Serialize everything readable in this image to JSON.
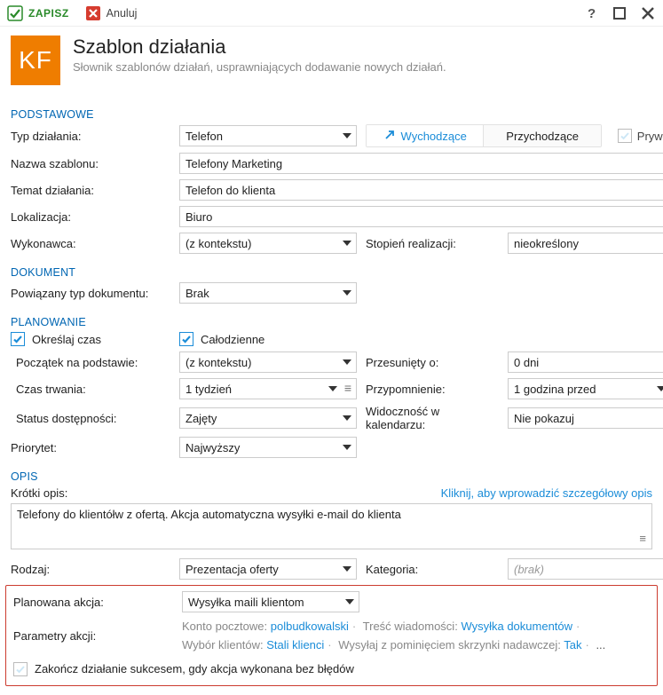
{
  "titlebar": {
    "save": "ZAPISZ",
    "cancel": "Anuluj"
  },
  "header": {
    "logo": "KF",
    "title": "Szablon działania",
    "subtitle": "Słownik szablonów działań, usprawniających dodawanie nowych działań."
  },
  "sections": {
    "basic": "PODSTAWOWE",
    "document": "DOKUMENT",
    "planning": "PLANOWANIE",
    "description": "OPIS"
  },
  "basic": {
    "type_label": "Typ działania:",
    "type_value": "Telefon",
    "direction": {
      "out": "Wychodzące",
      "in": "Przychodzące"
    },
    "private": "Prywatne",
    "name_label": "Nazwa szablonu:",
    "name_value": "Telefony Marketing",
    "subject_label": "Temat działania:",
    "subject_value": "Telefon do klienta",
    "location_label": "Lokalizacja:",
    "location_value": "Biuro",
    "performer_label": "Wykonawca:",
    "performer_value": "(z kontekstu)",
    "progress_label": "Stopień realizacji:",
    "progress_value": "nieokreślony"
  },
  "doc": {
    "linked_label": "Powiązany typ dokumentu:",
    "linked_value": "Brak"
  },
  "plan": {
    "define_time": "Określaj czas",
    "all_day": "Całodzienne",
    "start_basis_label": "Początek na podstawie:",
    "start_basis_value": "(z kontekstu)",
    "offset_label": "Przesunięty o:",
    "offset_value": "0 dni",
    "duration_label": "Czas trwania:",
    "duration_value": "1 tydzień",
    "reminder_label": "Przypomnienie:",
    "reminder_value": "1 godzina przed",
    "avail_label": "Status dostępności:",
    "avail_value": "Zajęty",
    "calvis_label": "Widoczność w kalendarzu:",
    "calvis_value": "Nie pokazuj",
    "priority_label": "Priorytet:",
    "priority_value": "Najwyższy"
  },
  "desc": {
    "short_label": "Krótki opis:",
    "details_link": "Kliknij, aby wprowadzić szczegółowy opis",
    "text": "Telefony do klientółw z ofertą. Akcja automatyczna wysyłki e-mail do klienta",
    "kind_label": "Rodzaj:",
    "kind_value": "Prezentacja oferty",
    "cat_label": "Kategoria:",
    "cat_placeholder": "(brak)"
  },
  "action": {
    "planned_label": "Planowana akcja:",
    "planned_value": "Wysyłka maili klientom",
    "params_label": "Parametry akcji:",
    "p1l": "Konto pocztowe:",
    "p1v": "polbudkowalski",
    "p2l": "Treść wiadomości:",
    "p2v": "Wysyłka dokumentów",
    "p3l": "Wybór klientów:",
    "p3v": "Stali klienci",
    "p4l": "Wysyłaj z pominięciem skrzynki nadawczej:",
    "p4v": "Tak",
    "more": "...",
    "end_label": "Zakończ działanie sukcesem, gdy akcja wykonana bez błędów"
  }
}
